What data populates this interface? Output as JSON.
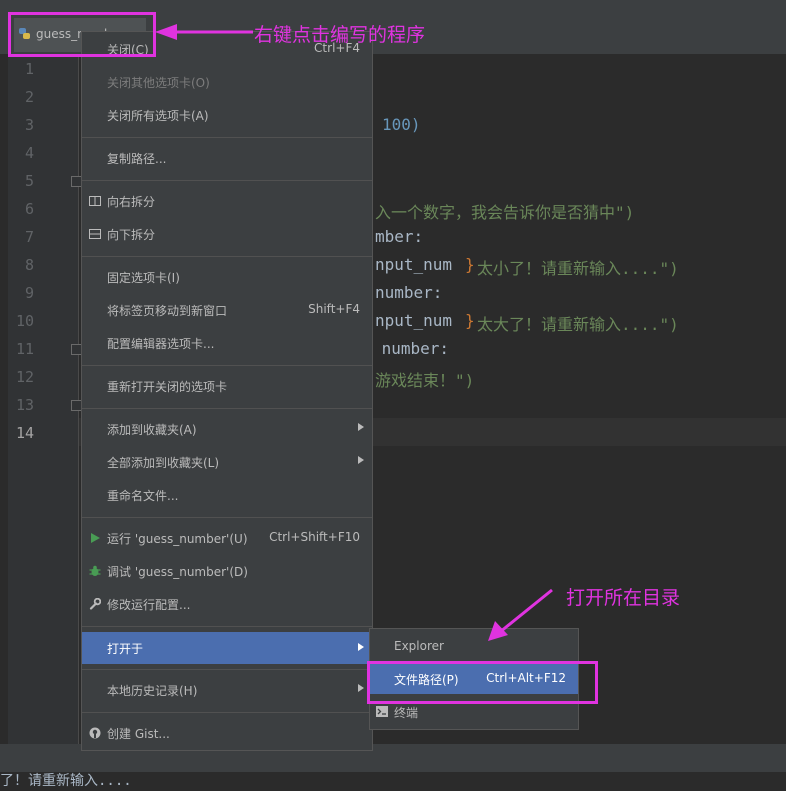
{
  "tab": {
    "label": "guess_number",
    "icon": "python-file-icon"
  },
  "gutter": {
    "line_numbers": [
      "1",
      "2",
      "3",
      "4",
      "5",
      "6",
      "7",
      "8",
      "9",
      "10",
      "11",
      "12",
      "13",
      "14"
    ]
  },
  "code_fragments": [
    {
      "text": "100)",
      "color": "#6897bb"
    },
    {
      "text": "入一个数字，我会告诉你是否猜中\")",
      "color": "#6a8759"
    },
    {
      "text": "mber:",
      "color": "#a9b7c6"
    },
    {
      "text": "nput_num",
      "color": "#a9b7c6"
    },
    {
      "text": "}",
      "color": "#cc7832"
    },
    {
      "text": "太小了！请重新输入....\")",
      "color": "#6a8759"
    },
    {
      "text": "number:",
      "color": "#a9b7c6"
    },
    {
      "text": "nput_num",
      "color": "#a9b7c6"
    },
    {
      "text": "}",
      "color": "#cc7832"
    },
    {
      "text": "太大了！请重新输入....\")",
      "color": "#6a8759"
    },
    {
      "text": " number:",
      "color": "#a9b7c6"
    },
    {
      "text": "游戏结束！\")",
      "color": "#6a8759"
    }
  ],
  "console": {
    "text": "了！请重新输入...."
  },
  "context_menu": {
    "items": [
      {
        "label": "关闭(C)",
        "shortcut": "Ctrl+F4"
      },
      {
        "label": "关闭其他选项卡(O)",
        "disabled": true
      },
      {
        "label": "关闭所有选项卡(A)"
      },
      {
        "label": "复制路径..."
      },
      {
        "label": "向右拆分",
        "icon": "split-vertical-icon"
      },
      {
        "label": "向下拆分",
        "icon": "split-horizontal-icon"
      },
      {
        "label": "固定选项卡(I)"
      },
      {
        "label": "将标签页移动到新窗口",
        "shortcut": "Shift+F4"
      },
      {
        "label": "配置编辑器选项卡..."
      },
      {
        "label": "重新打开关闭的选项卡"
      },
      {
        "label": "添加到收藏夹(A)",
        "submenu": true
      },
      {
        "label": "全部添加到收藏夹(L)",
        "submenu": true
      },
      {
        "label": "重命名文件..."
      },
      {
        "label": "运行 'guess_number'(U)",
        "shortcut": "Ctrl+Shift+F10",
        "icon": "run-icon"
      },
      {
        "label": "调试 'guess_number'(D)",
        "icon": "debug-icon"
      },
      {
        "label": "修改运行配置...",
        "icon": "wrench-icon"
      },
      {
        "label": "打开于",
        "submenu": true,
        "selected": true
      },
      {
        "label": "本地历史记录(H)",
        "submenu": true
      },
      {
        "label": "创建 Gist...",
        "icon": "github-icon"
      }
    ]
  },
  "submenu": {
    "items": [
      {
        "label": "Explorer"
      },
      {
        "label": "文件路径(P)",
        "shortcut": "Ctrl+Alt+F12",
        "selected": true
      },
      {
        "label": "终端",
        "icon": "terminal-icon"
      }
    ]
  },
  "annotations": {
    "top": "右键点击编写的程序",
    "bottom": "打开所在目录",
    "color": "#e033e0"
  }
}
